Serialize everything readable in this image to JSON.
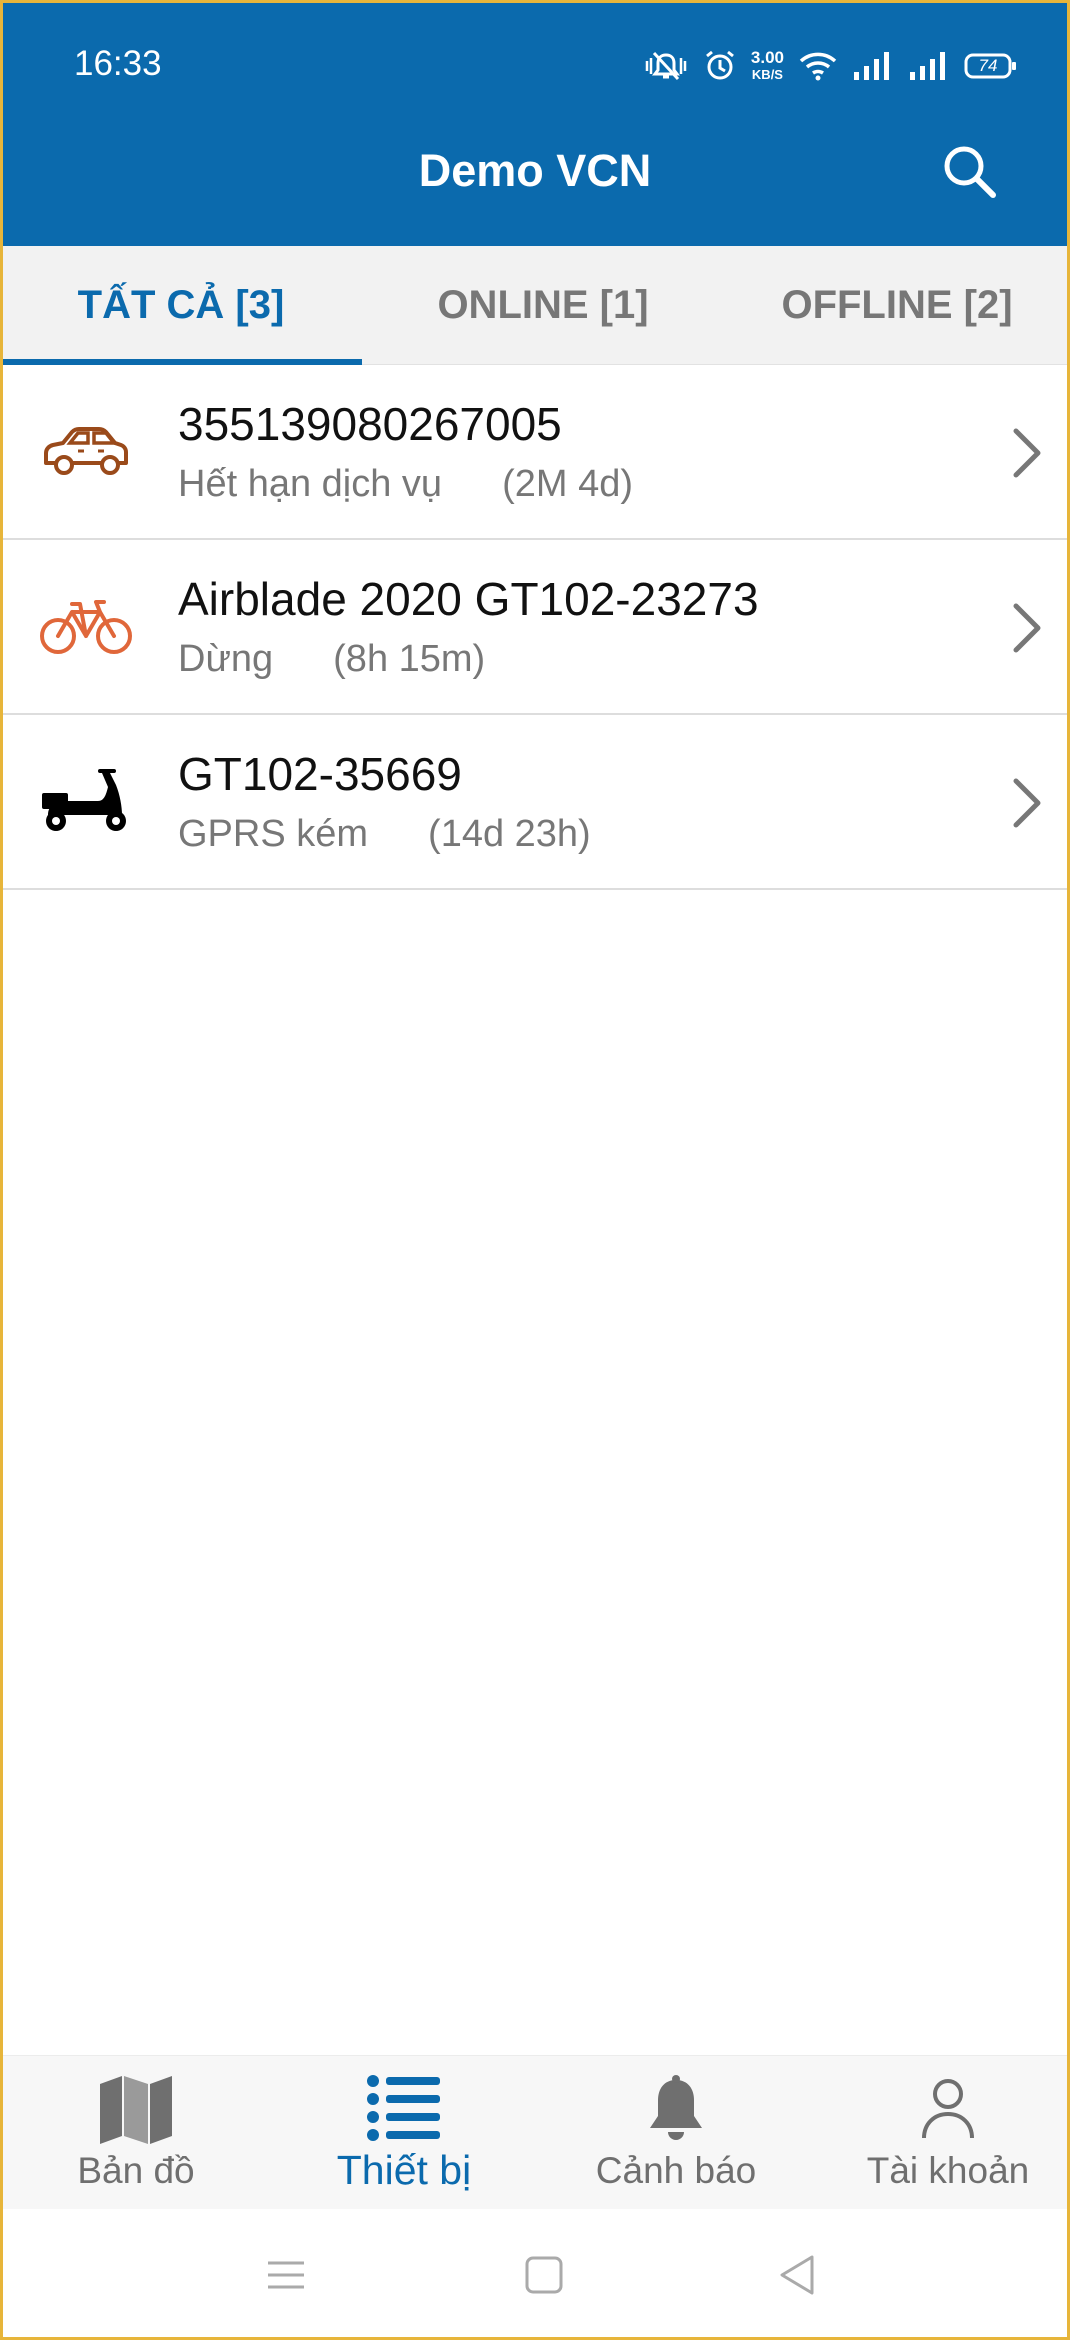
{
  "status_bar": {
    "time": "16:33",
    "net_speed_value": "3.00",
    "net_speed_unit": "KB/S",
    "battery": "74",
    "icons": [
      "mute-vibrate-icon",
      "alarm-icon",
      "wifi-icon",
      "signal-icon",
      "signal-icon",
      "battery-icon"
    ]
  },
  "app_bar": {
    "title": "Demo VCN",
    "search_icon": "search-icon"
  },
  "tabs": [
    {
      "label": "TẤT CẢ [3]",
      "active": true
    },
    {
      "label": "ONLINE [1]",
      "active": false
    },
    {
      "label": "OFFLINE [2]",
      "active": false
    }
  ],
  "devices": [
    {
      "icon": "car-icon",
      "name": "355139080267005",
      "status": "Hết hạn dịch vụ",
      "duration": "(2M 4d)",
      "color": "#9a4a1a"
    },
    {
      "icon": "bicycle-icon",
      "name": "Airblade 2020 GT102-23273",
      "status": "Dừng",
      "duration": "(8h 15m)",
      "color": "#e0673a"
    },
    {
      "icon": "scooter-icon",
      "name": "GT102-35669",
      "status": "GPRS kém",
      "duration": "(14d 23h)",
      "color": "#000000"
    }
  ],
  "bottom_nav": [
    {
      "label": "Bản đồ",
      "icon": "map-icon",
      "active": false
    },
    {
      "label": "Thiết bị",
      "icon": "list-icon",
      "active": true
    },
    {
      "label": "Cảnh báo",
      "icon": "bell-icon",
      "active": false
    },
    {
      "label": "Tài khoản",
      "icon": "user-icon",
      "active": false
    }
  ],
  "colors": {
    "primary": "#0b6aad",
    "tab_inactive": "#777777",
    "nav_inactive": "#6f6f6f"
  }
}
